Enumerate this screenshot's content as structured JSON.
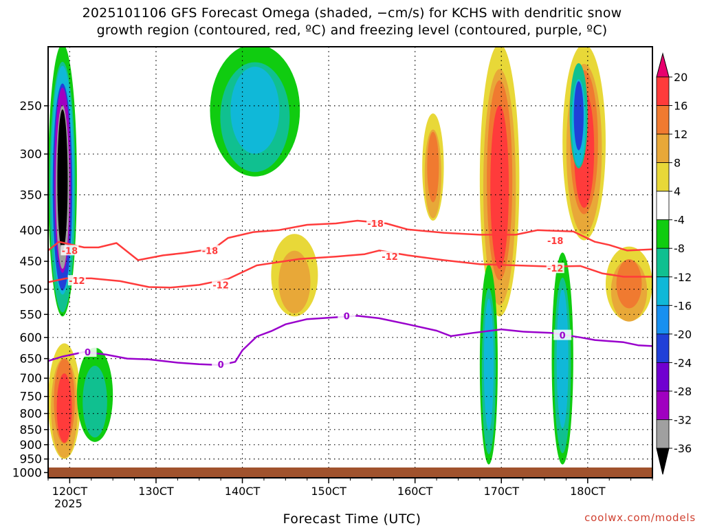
{
  "title_line1": "2025101106 GFS Forecast Omega (shaded, −cm/s) for KCHS with dendritic snow",
  "title_line2": "growth region (contoured, red, ºC) and freezing level (contoured, purple, ºC)",
  "credit": "coolwx.com/models",
  "chart_data": {
    "type": "heatmap",
    "title": "2025101106 GFS Forecast Omega (shaded, −cm/s) for KCHS with dendritic snow growth region (contoured, red, ºC) and freezing level (contoured, purple, ºC)",
    "xlabel": "Forecast Time (UTC)",
    "ylabel": "",
    "x_ticks": [
      "120CT",
      "130CT",
      "140CT",
      "150CT",
      "160CT",
      "170CT",
      "180CT"
    ],
    "x_tick_sublabel": "2025",
    "x_range_hours": [
      0,
      168
    ],
    "y_ticks": [
      250,
      300,
      350,
      400,
      450,
      500,
      550,
      600,
      650,
      700,
      750,
      800,
      850,
      900,
      950,
      1000
    ],
    "y_range_hpa": [
      200,
      1020
    ],
    "colorbar": {
      "labels": [
        "20",
        "16",
        "12",
        "8",
        "4",
        "-4",
        "-8",
        "-12",
        "-16",
        "-20",
        "-24",
        "-28",
        "-32",
        "-36"
      ],
      "colors": [
        "#e8006e",
        "#ff3b3b",
        "#f07a30",
        "#e8a838",
        "#e8d838",
        "#ffffff",
        "#10cc10",
        "#10c090",
        "#10b8d8",
        "#1890f0",
        "#2040d8",
        "#7000d0",
        "#a000c0",
        "#a0a0a0",
        "#000000"
      ]
    },
    "contours": [
      {
        "label": "-18",
        "color": "#ff3b3b",
        "points": [
          [
            0,
            432
          ],
          [
            3,
            418
          ],
          [
            10,
            427
          ],
          [
            14,
            427
          ],
          [
            19,
            420
          ],
          [
            25,
            448
          ],
          [
            32,
            440
          ],
          [
            38,
            436
          ],
          [
            46,
            429
          ],
          [
            50,
            412
          ],
          [
            57,
            403
          ],
          [
            64,
            400
          ],
          [
            72,
            392
          ],
          [
            80,
            390
          ],
          [
            86,
            386
          ],
          [
            94,
            390
          ],
          [
            100,
            399
          ],
          [
            110,
            404
          ],
          [
            120,
            407
          ],
          [
            130,
            407
          ],
          [
            136,
            400
          ],
          [
            146,
            402
          ],
          [
            152,
            418
          ],
          [
            156,
            423
          ],
          [
            161,
            432
          ],
          [
            168,
            430
          ]
        ],
        "label_positions": [
          [
            6,
            432
          ],
          [
            45,
            432
          ],
          [
            91,
            390
          ],
          [
            141,
            416
          ]
        ]
      },
      {
        "label": "-12",
        "color": "#ff3b3b",
        "points": [
          [
            0,
            487
          ],
          [
            5,
            480
          ],
          [
            12,
            480
          ],
          [
            20,
            485
          ],
          [
            28,
            496
          ],
          [
            34,
            497
          ],
          [
            42,
            492
          ],
          [
            50,
            481
          ],
          [
            58,
            457
          ],
          [
            70,
            446
          ],
          [
            80,
            442
          ],
          [
            88,
            438
          ],
          [
            92,
            432
          ],
          [
            100,
            440
          ],
          [
            110,
            448
          ],
          [
            120,
            455
          ],
          [
            130,
            457
          ],
          [
            140,
            459
          ],
          [
            148,
            458
          ],
          [
            154,
            471
          ],
          [
            160,
            477
          ],
          [
            168,
            477
          ]
        ],
        "label_positions": [
          [
            8,
            484
          ],
          [
            48,
            492
          ],
          [
            95,
            442
          ],
          [
            141,
            462
          ]
        ]
      },
      {
        "label": "0",
        "color": "#9900cc",
        "points": [
          [
            0,
            656
          ],
          [
            4,
            645
          ],
          [
            10,
            634
          ],
          [
            16,
            640
          ],
          [
            22,
            650
          ],
          [
            28,
            652
          ],
          [
            36,
            660
          ],
          [
            42,
            664
          ],
          [
            48,
            666
          ],
          [
            52,
            658
          ],
          [
            54,
            630
          ],
          [
            58,
            598
          ],
          [
            62,
            586
          ],
          [
            66,
            571
          ],
          [
            72,
            560
          ],
          [
            80,
            556
          ],
          [
            86,
            553
          ],
          [
            92,
            558
          ],
          [
            100,
            571
          ],
          [
            108,
            585
          ],
          [
            112,
            597
          ],
          [
            118,
            590
          ],
          [
            126,
            582
          ],
          [
            132,
            587
          ],
          [
            140,
            590
          ],
          [
            148,
            600
          ],
          [
            152,
            606
          ],
          [
            160,
            611
          ],
          [
            164,
            618
          ],
          [
            168,
            620
          ]
        ],
        "label_positions": [
          [
            11,
            634
          ],
          [
            48,
            664
          ],
          [
            83,
            553
          ],
          [
            143,
            595
          ]
        ]
      }
    ],
    "shading_blobs": [
      {
        "value_range": "-8 to -32",
        "x_hours": [
          0,
          8
        ],
        "p_hpa": [
          200,
          560
        ]
      },
      {
        "value_range": "4 to 16",
        "x_hours": [
          0,
          9
        ],
        "p_hpa": [
          620,
          960
        ]
      },
      {
        "value_range": "-4 to -8",
        "x_hours": [
          8,
          18
        ],
        "p_hpa": [
          630,
          900
        ]
      },
      {
        "value_range": "-4 to -12",
        "x_hours": [
          45,
          70
        ],
        "p_hpa": [
          200,
          330
        ]
      },
      {
        "value_range": "4 to 8",
        "x_hours": [
          62,
          75
        ],
        "p_hpa": [
          410,
          560
        ]
      },
      {
        "value_range": "4 to 12",
        "x_hours": [
          104,
          110
        ],
        "p_hpa": [
          260,
          390
        ]
      },
      {
        "value_range": "4 to 20",
        "x_hours": [
          120,
          131
        ],
        "p_hpa": [
          200,
          560
        ]
      },
      {
        "value_range": "-4 to -12",
        "x_hours": [
          120,
          125
        ],
        "p_hpa": [
          460,
          980
        ]
      },
      {
        "value_range": "4 to 20",
        "x_hours": [
          143,
          155
        ],
        "p_hpa": [
          200,
          420
        ]
      },
      {
        "value_range": "-8 to -24",
        "x_hours": [
          145,
          150
        ],
        "p_hpa": [
          215,
          320
        ]
      },
      {
        "value_range": "-4 to -12",
        "x_hours": [
          140,
          146
        ],
        "p_hpa": [
          440,
          980
        ]
      },
      {
        "value_range": "4 to 12",
        "x_hours": [
          155,
          168
        ],
        "p_hpa": [
          430,
          570
        ]
      }
    ],
    "ground_band_hpa": 1015
  }
}
